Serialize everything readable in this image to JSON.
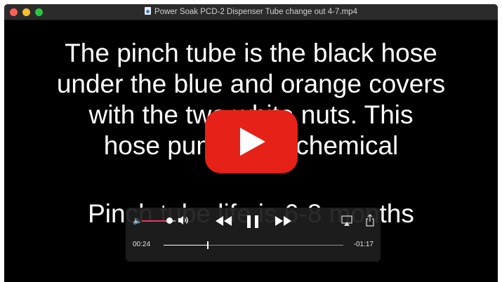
{
  "window": {
    "title": "Power Soak PCD-2 Dispenser Tube change out 4-7.mp4",
    "file_icon": "document-icon"
  },
  "video": {
    "caption_lines": [
      "The pinch tube is the black hose",
      "under the blue and orange covers",
      "with the two white nuts.  This",
      "hose pumps the chemical"
    ],
    "caption_sub": "Pinch tube life is 6-8 months",
    "play_icon": "youtube-play-icon"
  },
  "controls": {
    "elapsed": "00:24",
    "remaining": "-01:17",
    "progress_fraction": 0.245,
    "volume_fraction": 0.85,
    "icons": [
      "volume-low-icon",
      "volume-high-icon",
      "rewind-icon",
      "pause-icon",
      "fast-forward-icon",
      "airplay-icon",
      "share-icon"
    ]
  },
  "colors": {
    "accent_volume": "#e8355d",
    "youtube_red": "#e62117",
    "close": "#ff5f57",
    "minimize": "#febc2e",
    "maximize": "#28c840"
  }
}
